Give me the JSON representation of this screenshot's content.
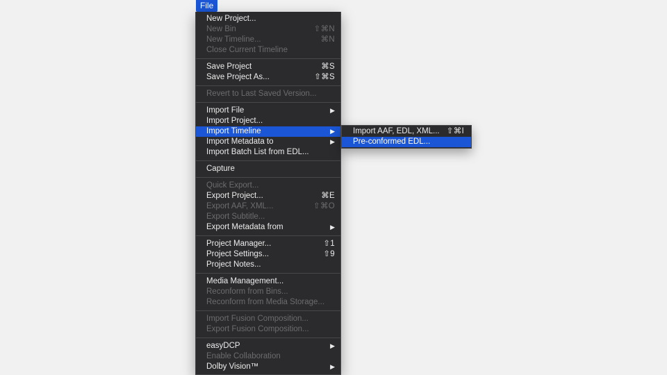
{
  "menu_title": "File",
  "menu": {
    "groups": [
      [
        {
          "label": "New Project...",
          "shortcut": "",
          "disabled": false
        },
        {
          "label": "New Bin",
          "shortcut": "⇧⌘N",
          "disabled": true
        },
        {
          "label": "New Timeline...",
          "shortcut": "⌘N",
          "disabled": true
        },
        {
          "label": "Close Current Timeline",
          "shortcut": "",
          "disabled": true
        }
      ],
      [
        {
          "label": "Save Project",
          "shortcut": "⌘S",
          "disabled": false
        },
        {
          "label": "Save Project As...",
          "shortcut": "⇧⌘S",
          "disabled": false
        }
      ],
      [
        {
          "label": "Revert to Last Saved Version...",
          "shortcut": "",
          "disabled": true
        }
      ],
      [
        {
          "label": "Import File",
          "submenu": true,
          "disabled": false
        },
        {
          "label": "Import Project...",
          "shortcut": "",
          "disabled": false
        },
        {
          "label": "Import Timeline",
          "submenu": true,
          "disabled": false,
          "selected": true
        },
        {
          "label": "Import Metadata to",
          "submenu": true,
          "disabled": false
        },
        {
          "label": "Import Batch List from EDL...",
          "shortcut": "",
          "disabled": false
        }
      ],
      [
        {
          "label": "Capture",
          "shortcut": "",
          "disabled": false
        }
      ],
      [
        {
          "label": "Quick Export...",
          "shortcut": "",
          "disabled": true
        },
        {
          "label": "Export Project...",
          "shortcut": "⌘E",
          "disabled": false
        },
        {
          "label": "Export AAF, XML...",
          "shortcut": "⇧⌘O",
          "disabled": true
        },
        {
          "label": "Export Subtitle...",
          "shortcut": "",
          "disabled": true
        },
        {
          "label": "Export Metadata from",
          "submenu": true,
          "disabled": false
        }
      ],
      [
        {
          "label": "Project Manager...",
          "shortcut": "⇧1",
          "disabled": false
        },
        {
          "label": "Project Settings...",
          "shortcut": "⇧9",
          "disabled": false
        },
        {
          "label": "Project Notes...",
          "shortcut": "",
          "disabled": false
        }
      ],
      [
        {
          "label": "Media Management...",
          "shortcut": "",
          "disabled": false
        },
        {
          "label": "Reconform from Bins...",
          "shortcut": "",
          "disabled": true
        },
        {
          "label": "Reconform from Media Storage...",
          "shortcut": "",
          "disabled": true
        }
      ],
      [
        {
          "label": "Import Fusion Composition...",
          "shortcut": "",
          "disabled": true
        },
        {
          "label": "Export Fusion Composition...",
          "shortcut": "",
          "disabled": true
        }
      ],
      [
        {
          "label": "easyDCP",
          "submenu": true,
          "disabled": false
        },
        {
          "label": "Enable Collaboration",
          "shortcut": "",
          "disabled": true
        },
        {
          "label": "Dolby Vision™",
          "submenu": true,
          "disabled": false
        }
      ]
    ]
  },
  "submenu": {
    "items": [
      {
        "label": "Import AAF, EDL, XML...",
        "shortcut": "⇧⌘I",
        "disabled": false
      },
      {
        "label": "Pre-conformed EDL...",
        "shortcut": "",
        "disabled": false,
        "selected": true
      }
    ]
  },
  "icons": {
    "submenu_arrow": "triangle-right-icon"
  },
  "colors": {
    "highlight": "#1a56d6",
    "menu_bg": "#2b2b2d",
    "page_bg": "#f1f1f1"
  }
}
